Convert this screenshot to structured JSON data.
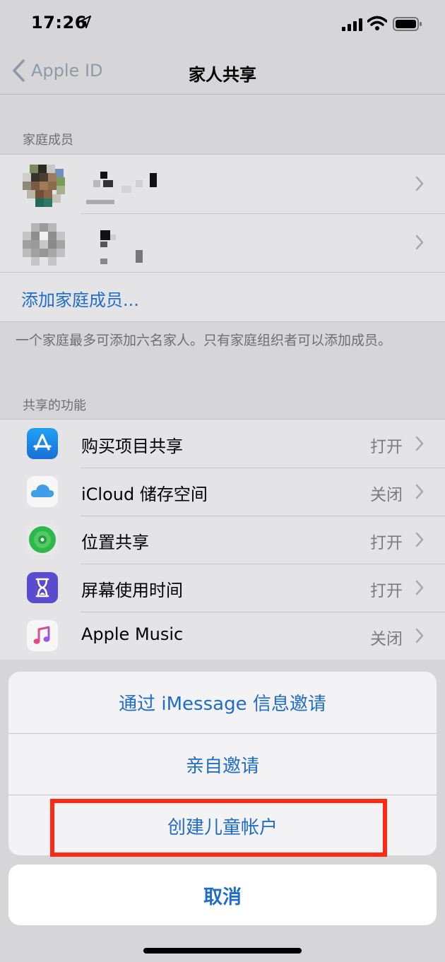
{
  "status_bar": {
    "time": "17:26"
  },
  "nav": {
    "back_label": "Apple ID",
    "title": "家人共享"
  },
  "family": {
    "section_title": "家庭成员",
    "add_member": "添加家庭成员...",
    "footnote": "一个家庭最多可添加六名家人。只有家庭组织者可以添加成员。"
  },
  "features": {
    "section_title": "共享的功能",
    "items": [
      {
        "label": "购买项目共享",
        "status": "打开",
        "icon": "app-store-icon"
      },
      {
        "label": "iCloud 储存空间",
        "status": "关闭",
        "icon": "icloud-icon"
      },
      {
        "label": "位置共享",
        "status": "打开",
        "icon": "find-my-icon"
      },
      {
        "label": "屏幕使用时间",
        "status": "打开",
        "icon": "screen-time-icon"
      },
      {
        "label": "Apple Music",
        "status": "关闭",
        "icon": "music-icon"
      }
    ]
  },
  "action_sheet": {
    "options": [
      "通过 iMessage 信息邀请",
      "亲自邀请",
      "创建儿童帐户"
    ],
    "cancel": "取消"
  },
  "colors": {
    "accent": "#1f6dc8",
    "highlight": "#ff2a14"
  }
}
